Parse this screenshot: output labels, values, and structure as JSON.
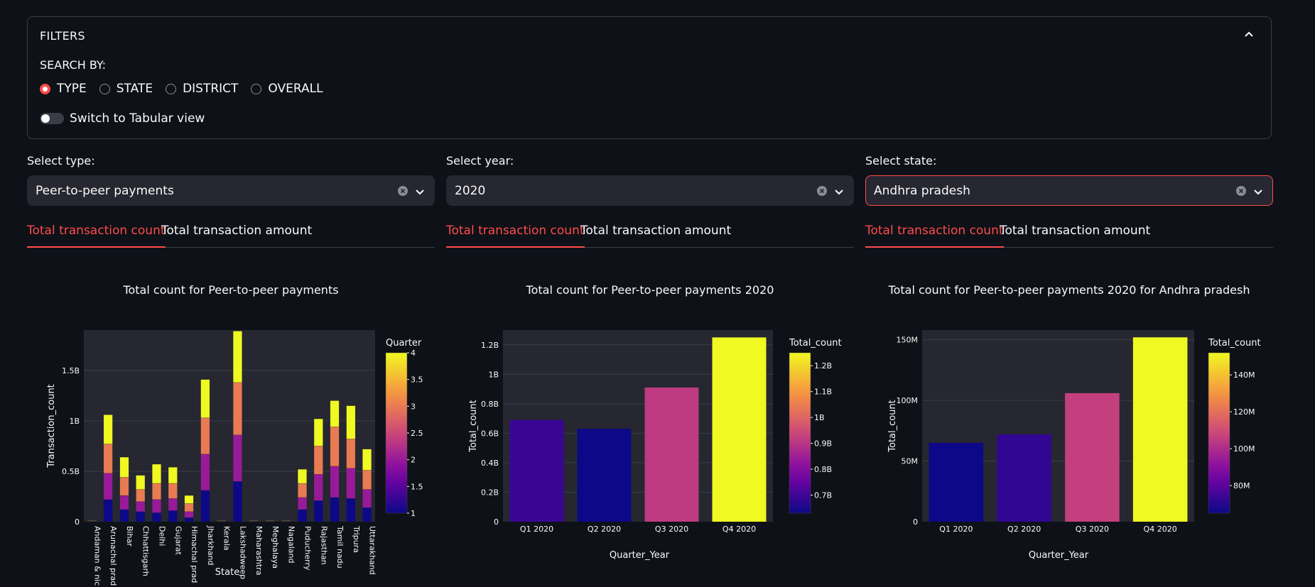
{
  "filters": {
    "title": "FILTERS",
    "search_by_label": "SEARCH BY:",
    "radios": [
      "TYPE",
      "STATE",
      "DISTRICT",
      "OVERALL"
    ],
    "selected_radio": "TYPE",
    "toggle_label": "Switch to Tabular view",
    "toggle_on": false
  },
  "columns": [
    {
      "select_label": "Select type:",
      "select_value": "Peer-to-peer payments",
      "tabs": [
        "Total transaction count",
        "Total transaction amount"
      ],
      "active_tab": 0,
      "chart_data": {
        "type": "bar",
        "title": "Total count for Peer-to-peer payments",
        "xlabel": "State",
        "ylabel": "Transaction_count",
        "stacked": true,
        "categories": [
          "Andaman & nic",
          "Arunachal prad",
          "Bihar",
          "Chhattisgarh",
          "Delhi",
          "Gujarat",
          "Himachal prad",
          "Jharkhand",
          "Kerala",
          "Lakshadweep",
          "Maharashtra",
          "Meghalaya",
          "Nagaland",
          "Puducherry",
          "Rajasthan",
          "Tamil nadu",
          "Tripura",
          "Uttarakhand"
        ],
        "series": [
          {
            "name": "1",
            "values": [
              0.003,
              0.22,
              0.12,
              0.1,
              0.09,
              0.11,
              0.04,
              0.31,
              0.003,
              0.4,
              0.003,
              0.003,
              0.003,
              0.12,
              0.21,
              0.24,
              0.23,
              0.14
            ]
          },
          {
            "name": "2",
            "values": [
              0.003,
              0.26,
              0.14,
              0.1,
              0.13,
              0.12,
              0.06,
              0.36,
              0.003,
              0.46,
              0.003,
              0.003,
              0.003,
              0.12,
              0.26,
              0.31,
              0.3,
              0.18
            ]
          },
          {
            "name": "3",
            "values": [
              0.003,
              0.29,
              0.18,
              0.12,
              0.16,
              0.15,
              0.08,
              0.36,
              0.003,
              0.52,
              0.003,
              0.003,
              0.003,
              0.14,
              0.28,
              0.39,
              0.29,
              0.19
            ]
          },
          {
            "name": "4",
            "values": [
              0.003,
              0.29,
              0.2,
              0.14,
              0.19,
              0.16,
              0.08,
              0.38,
              0.003,
              0.51,
              0.003,
              0.003,
              0.003,
              0.14,
              0.27,
              0.26,
              0.33,
              0.21
            ]
          }
        ],
        "y_ticks": [
          "0",
          "0.5B",
          "1B",
          "1.5B"
        ],
        "ylim": [
          0,
          1.9
        ],
        "legend_title": "Quarter",
        "colorbar_ticks": [
          "1",
          "1.5",
          "2",
          "2.5",
          "3",
          "3.5",
          "4"
        ],
        "colorbar_range": [
          1,
          4
        ]
      }
    },
    {
      "select_label": "Select year:",
      "select_value": "2020",
      "tabs": [
        "Total transaction count",
        "Total transaction amount"
      ],
      "active_tab": 0,
      "chart_data": {
        "type": "bar",
        "title": "Total count for Peer-to-peer payments 2020",
        "xlabel": "Quarter_Year",
        "ylabel": "Total_count",
        "categories": [
          "Q1 2020",
          "Q2 2020",
          "Q3 2020",
          "Q4 2020"
        ],
        "values": [
          0.69,
          0.63,
          0.91,
          1.25
        ],
        "y_ticks": [
          "0",
          "0.2B",
          "0.4B",
          "0.6B",
          "0.8B",
          "1B",
          "1.2B"
        ],
        "ylim": [
          0,
          1.3
        ],
        "legend_title": "Total_count",
        "colorbar_ticks": [
          "0.7B",
          "0.8B",
          "0.9B",
          "1B",
          "1.1B",
          "1.2B"
        ],
        "colorbar_range": [
          0.63,
          1.25
        ]
      }
    },
    {
      "select_label": "Select state:",
      "select_value": "Andhra pradesh",
      "tabs": [
        "Total transaction count",
        "Total transaction amount"
      ],
      "active_tab": 0,
      "chart_data": {
        "type": "bar",
        "title": "Total count for Peer-to-peer payments 2020 for Andhra pradesh",
        "xlabel": "Quarter_Year",
        "ylabel": "Total_count",
        "categories": [
          "Q1 2020",
          "Q2 2020",
          "Q3 2020",
          "Q4 2020"
        ],
        "values": [
          65,
          72,
          106,
          152
        ],
        "y_ticks": [
          "0",
          "50M",
          "100M",
          "150M"
        ],
        "ylim": [
          0,
          158
        ],
        "legend_title": "Total_count",
        "colorbar_ticks": [
          "80M",
          "100M",
          "120M",
          "140M"
        ],
        "colorbar_range": [
          65,
          152
        ]
      }
    }
  ]
}
